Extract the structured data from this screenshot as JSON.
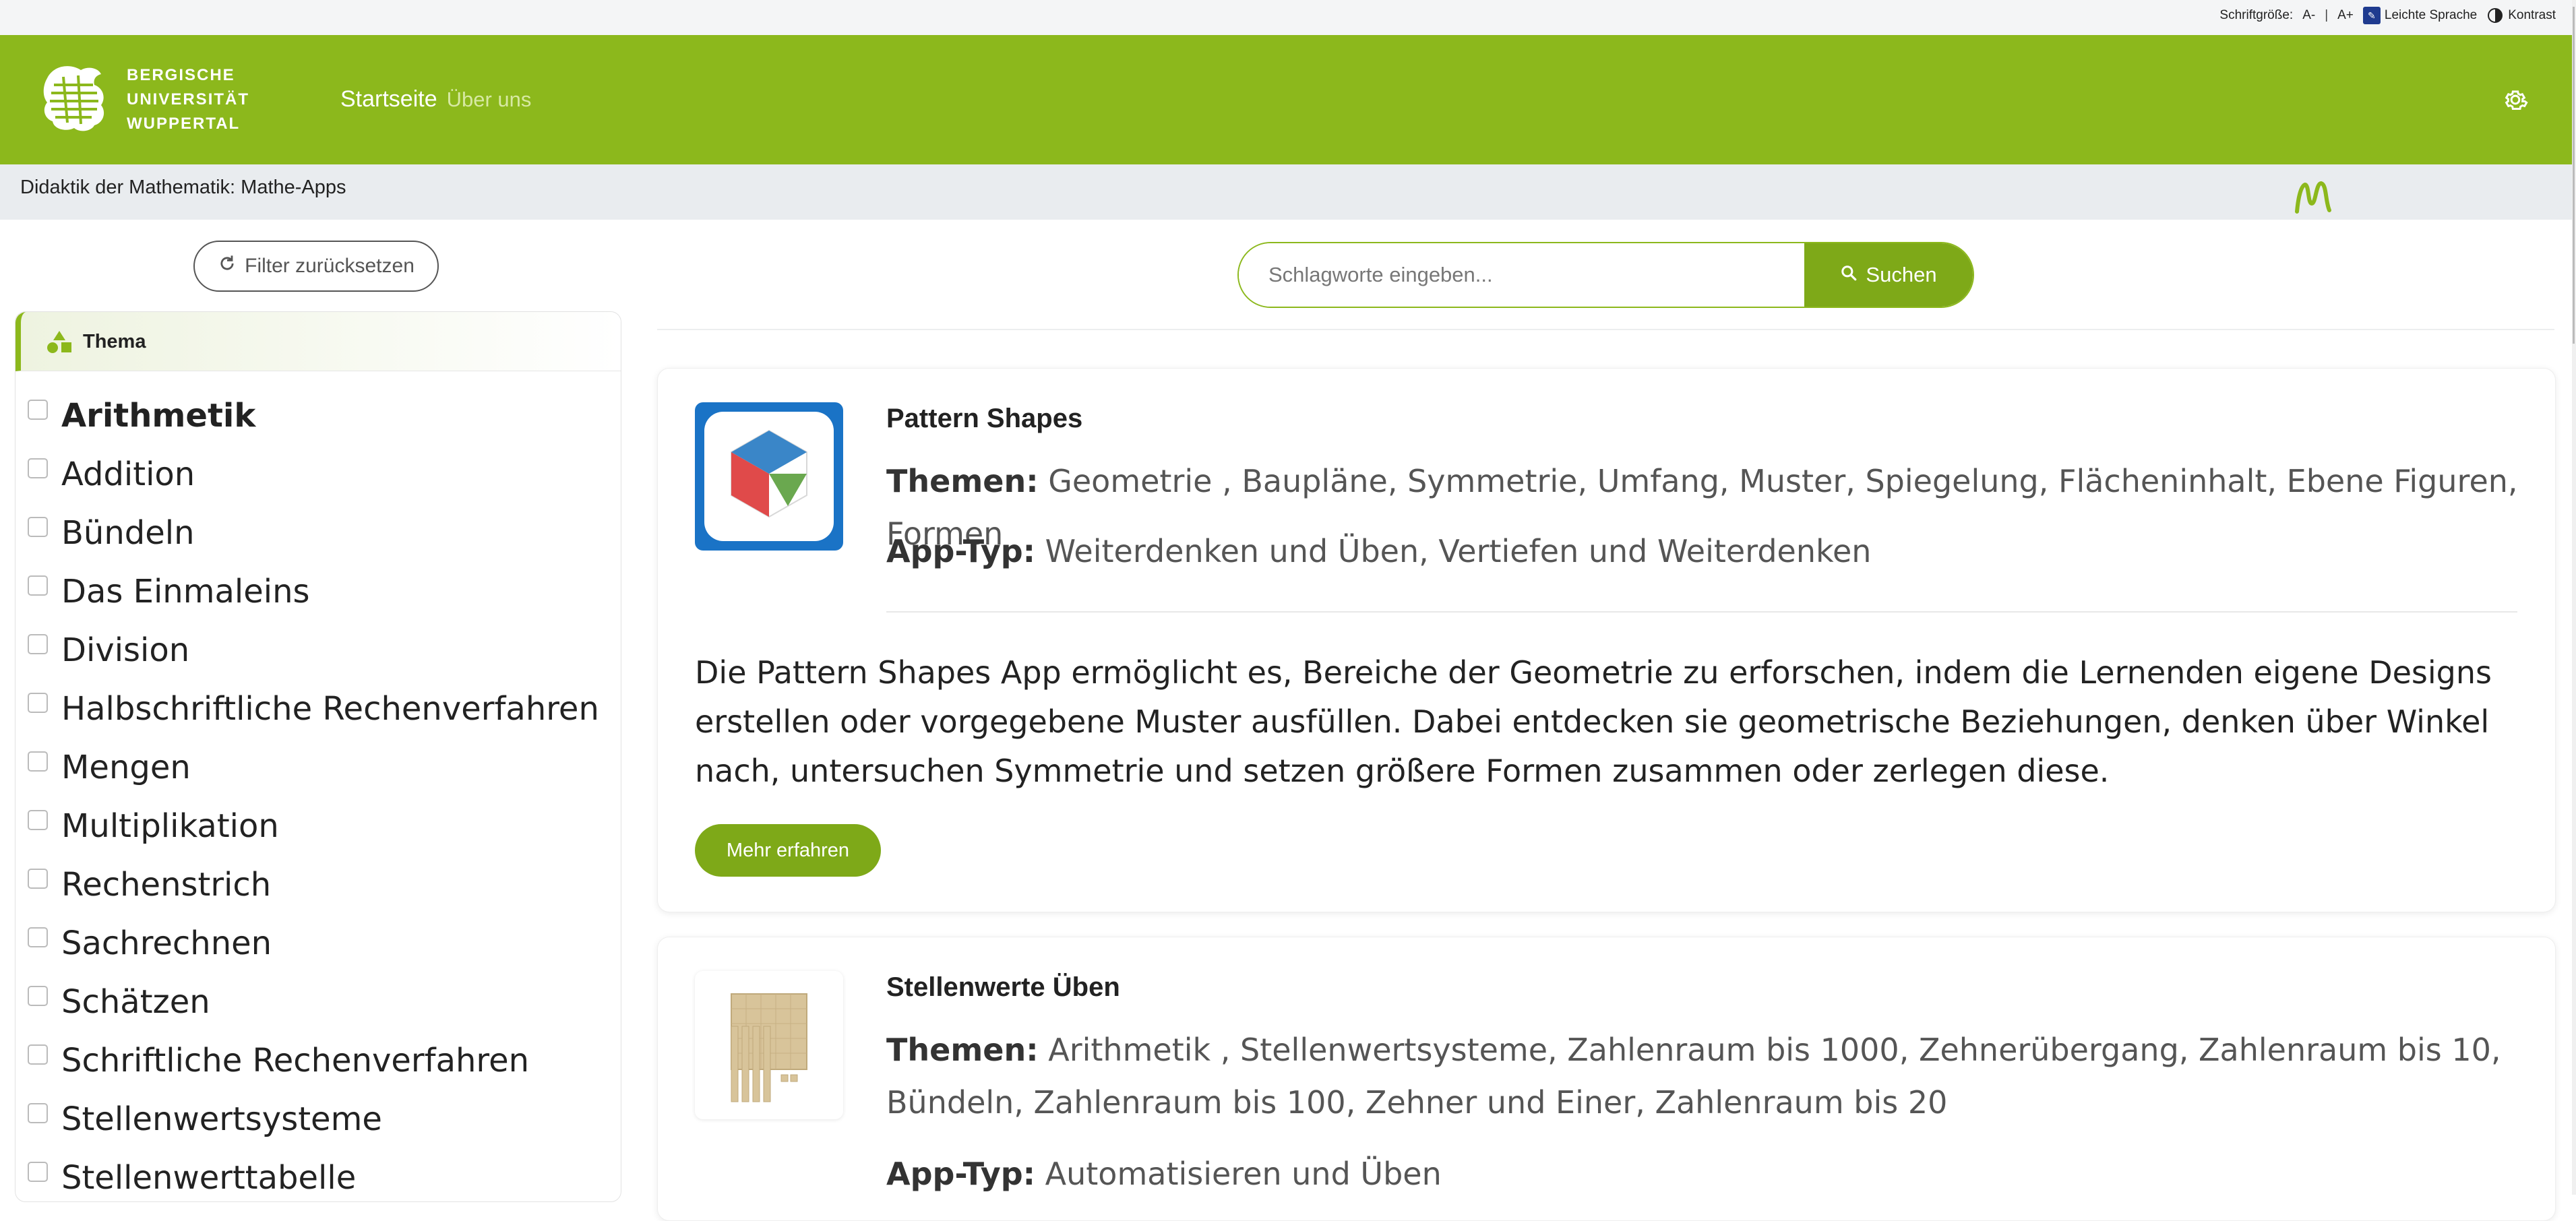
{
  "utility": {
    "font_size_label": "Schriftgröße:",
    "font_decrease": "A-",
    "separator": "|",
    "font_increase": "A+",
    "easy_language": "Leichte Sprache",
    "contrast": "Kontrast"
  },
  "header": {
    "logo_lines": [
      "BERGISCHE",
      "UNIVERSITÄT",
      "WUPPERTAL"
    ],
    "nav": {
      "home": "Startseite",
      "about": "Über uns"
    },
    "settings_icon": "gear-icon",
    "brand_color": "#8cb81c"
  },
  "breadcrumb": "Didaktik der Mathematik: Mathe-Apps",
  "sidebar": {
    "reset_label": "Filter zurücksetzen",
    "panel_title": "Thema",
    "filters": [
      "Arithmetik",
      "Addition",
      "Bündeln",
      "Das Einmaleins",
      "Division",
      "Halbschriftliche Rechenverfahren",
      "Mengen",
      "Multiplikation",
      "Rechenstrich",
      "Sachrechnen",
      "Schätzen",
      "Schriftliche Rechenverfahren",
      "Stellenwertsysteme",
      "Stellenwerttabelle"
    ]
  },
  "search": {
    "placeholder": "Schlagworte eingeben...",
    "button_label": "Suchen"
  },
  "apps": [
    {
      "title": "Pattern Shapes",
      "themen_label": "Themen:",
      "themen": "Geometrie , Baupläne, Symmetrie, Umfang, Muster, Spiegelung, Flächeninhalt, Ebene Figuren, Formen",
      "apptyp_label": "App-Typ:",
      "apptyp": "Weiterdenken und Üben, Vertiefen und Weiterdenken",
      "description": "Die Pattern Shapes App ermöglicht es, Bereiche der Geometrie zu erforschen, indem die Lernenden eigene Designs erstellen oder vorgegebene Muster ausfüllen. Dabei entdecken sie geometrische Beziehungen, denken über Winkel nach, untersuchen Symmetrie und setzen größere Formen zusammen oder zerlegen diese.",
      "more_label": "Mehr erfahren"
    },
    {
      "title": "Stellenwerte Üben",
      "themen_label": "Themen:",
      "themen": "Arithmetik , Stellenwertsysteme, Zahlenraum bis 1000, Zehnerübergang, Zahlenraum bis 10, Bündeln, Zahlenraum bis 100, Zehner und Einer, Zahlenraum bis 20",
      "apptyp_label": "App-Typ:",
      "apptyp": "Automatisieren und Üben"
    }
  ]
}
